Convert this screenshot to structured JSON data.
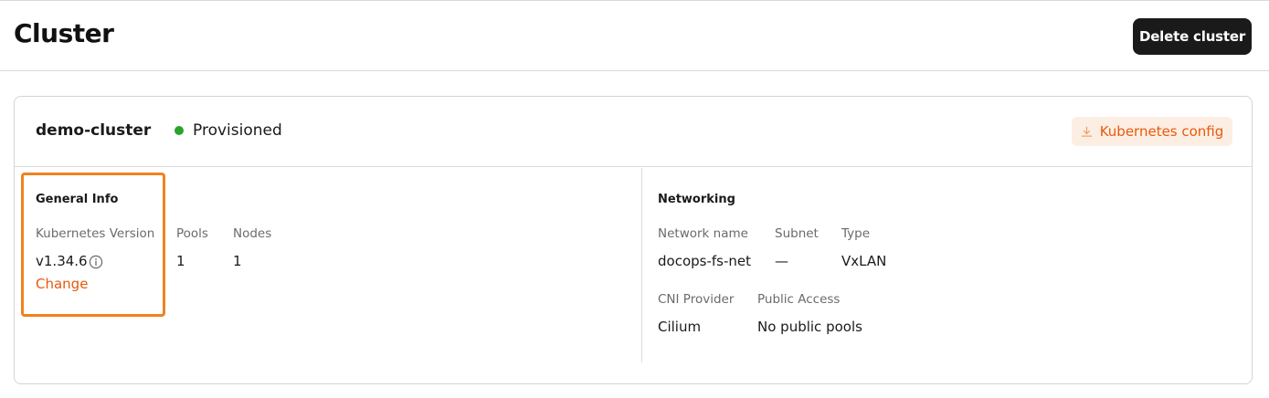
{
  "header": {
    "title": "Cluster",
    "delete_label": "Delete cluster"
  },
  "cluster": {
    "name": "demo-cluster",
    "status": "Provisioned",
    "status_color": "#2aa32a",
    "config_label": "Kubernetes config",
    "accent_color": "#e8590c"
  },
  "general_info": {
    "title": "General Info",
    "k8s_version_label": "Kubernetes Version",
    "k8s_version": "v1.34.6",
    "change_label": "Change",
    "pools_label": "Pools",
    "pools": "1",
    "nodes_label": "Nodes",
    "nodes": "1"
  },
  "networking": {
    "title": "Networking",
    "network_name_label": "Network name",
    "network_name": "docops-fs-net",
    "subnet_label": "Subnet",
    "subnet": "—",
    "type_label": "Type",
    "type": "VxLAN",
    "cni_label": "CNI Provider",
    "cni": "Cilium",
    "public_access_label": "Public Access",
    "public_access": "No public pools"
  }
}
